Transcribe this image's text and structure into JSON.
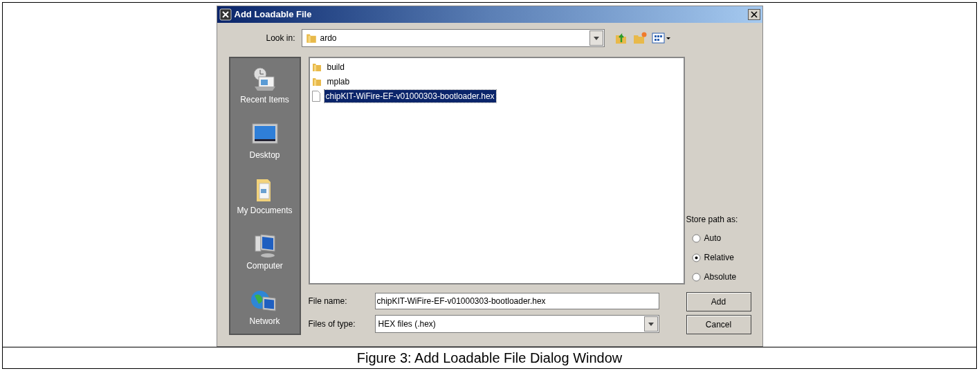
{
  "window": {
    "title": "Add Loadable File"
  },
  "look_in": {
    "label": "Look in:",
    "value": "ardo"
  },
  "places": [
    {
      "label": "Recent Items",
      "kind": "recent"
    },
    {
      "label": "Desktop",
      "kind": "desktop"
    },
    {
      "label": "My Documents",
      "kind": "documents"
    },
    {
      "label": "Computer",
      "kind": "computer"
    },
    {
      "label": "Network",
      "kind": "network"
    }
  ],
  "files": [
    {
      "name": "build",
      "kind": "folder",
      "selected": false
    },
    {
      "name": "mplab",
      "kind": "folder",
      "selected": false
    },
    {
      "name": "chipKIT-WiFire-EF-v01000303-bootloader.hex",
      "kind": "file",
      "selected": true
    }
  ],
  "file_name": {
    "label": "File name:",
    "value": "chipKIT-WiFire-EF-v01000303-bootloader.hex"
  },
  "file_type": {
    "label": "Files of type:",
    "value": "HEX files (.hex)"
  },
  "store_path": {
    "label": "Store path as:",
    "options": [
      {
        "label": "Auto",
        "selected": false
      },
      {
        "label": "Relative",
        "selected": true
      },
      {
        "label": "Absolute",
        "selected": false
      }
    ]
  },
  "buttons": [
    "Add",
    "Cancel"
  ],
  "caption": "Figure 3: Add Loadable File Dialog Window"
}
